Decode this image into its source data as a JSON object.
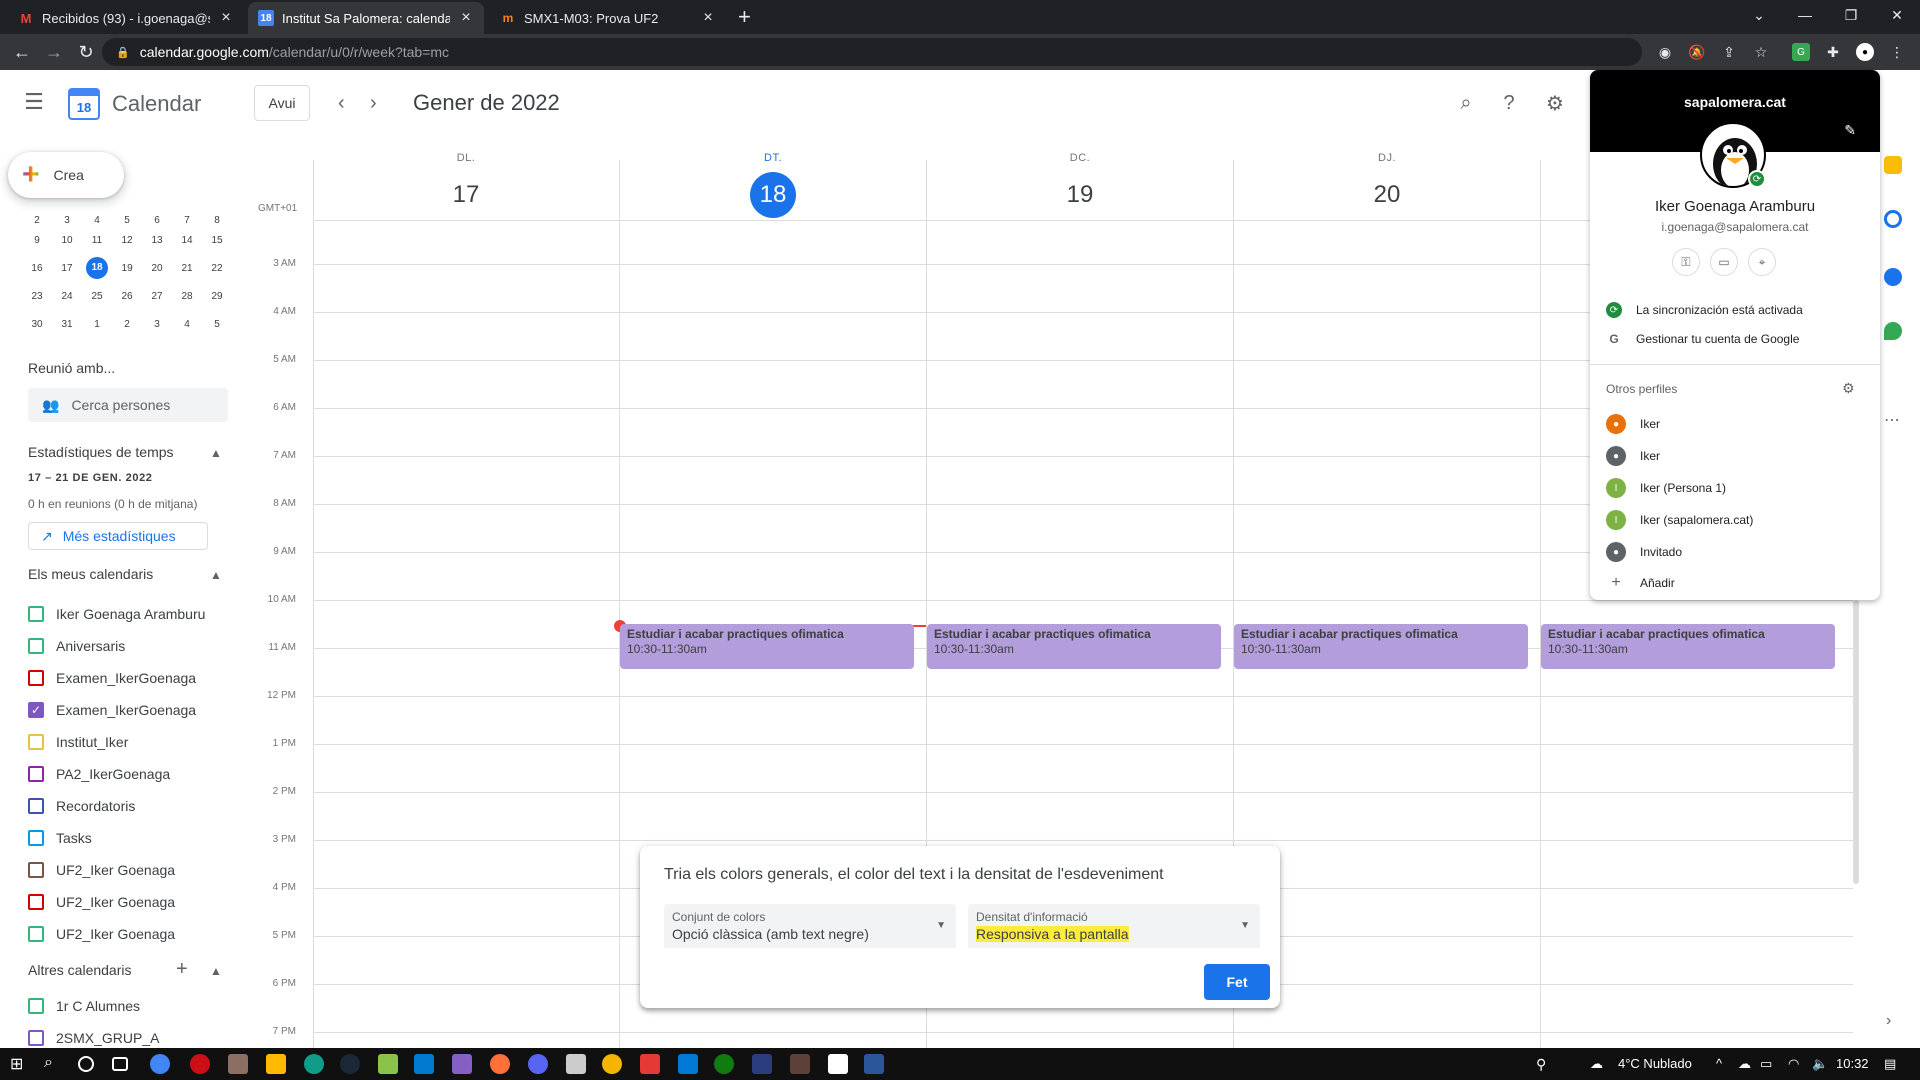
{
  "browser": {
    "tabs": [
      {
        "title": "Recibidos (93) - i.goenaga@sapa",
        "favicon": "gmail-icon"
      },
      {
        "title": "Institut Sa Palomera: calendari - S",
        "favicon": "calendar-icon"
      },
      {
        "title": "SMX1-M03: Prova UF2",
        "favicon": "moodle-icon"
      }
    ],
    "url_host": "calendar.google.com",
    "url_path": "/calendar/u/0/r/week?tab=mc"
  },
  "header": {
    "app_name": "Calendar",
    "logo_day": "18",
    "today_label": "Avui",
    "title": "Gener de 2022"
  },
  "sidebar": {
    "create_label": "Crea",
    "mini_calendar": [
      [
        "2",
        "3",
        "4",
        "5",
        "6",
        "7",
        "8"
      ],
      [
        "9",
        "10",
        "11",
        "12",
        "13",
        "14",
        "15"
      ],
      [
        "16",
        "17",
        "18",
        "19",
        "20",
        "21",
        "22"
      ],
      [
        "23",
        "24",
        "25",
        "26",
        "27",
        "28",
        "29"
      ],
      [
        "30",
        "31",
        "1",
        "2",
        "3",
        "4",
        "5"
      ]
    ],
    "meet_heading": "Reunió amb...",
    "search_people_placeholder": "Cerca persones",
    "stats_heading": "Estadístiques de temps",
    "stats_range": "17 – 21 DE GEN. 2022",
    "stats_summary": "0 h en reunions (0 h de mitjana)",
    "more_stats_label": "Més estadístiques",
    "my_calendars_heading": "Els meus calendaris",
    "my_calendars": [
      {
        "label": "Iker Goenaga Aramburu",
        "color": "#33b679",
        "checked": false
      },
      {
        "label": "Aniversaris",
        "color": "#33b679",
        "checked": false
      },
      {
        "label": "Examen_IkerGoenaga",
        "color": "#d50000",
        "checked": false
      },
      {
        "label": "Examen_IkerGoenaga",
        "color": "#7e57c2",
        "checked": true
      },
      {
        "label": "Institut_Iker",
        "color": "#e4c441",
        "checked": false
      },
      {
        "label": "PA2_IkerGoenaga",
        "color": "#8e24aa",
        "checked": false
      },
      {
        "label": "Recordatoris",
        "color": "#3f51b5",
        "checked": false
      },
      {
        "label": "Tasks",
        "color": "#039be5",
        "checked": false
      },
      {
        "label": "UF2_Iker Goenaga",
        "color": "#795548",
        "checked": false
      },
      {
        "label": "UF2_Iker Goenaga",
        "color": "#d50000",
        "checked": false
      },
      {
        "label": "UF2_Iker Goenaga",
        "color": "#33b679",
        "checked": false
      }
    ],
    "other_calendars_heading": "Altres calendaris",
    "other_calendars": [
      {
        "label": "1r C Alumnes",
        "color": "#33b679",
        "checked": false
      },
      {
        "label": "2SMX_GRUP_A",
        "color": "#7e57c2",
        "checked": false
      }
    ]
  },
  "week": {
    "timezone": "GMT+01",
    "days": [
      {
        "name": "DL.",
        "num": "17",
        "today": false
      },
      {
        "name": "DT.",
        "num": "18",
        "today": true
      },
      {
        "name": "DC.",
        "num": "19",
        "today": false
      },
      {
        "name": "DJ.",
        "num": "20",
        "today": false
      }
    ],
    "hours": [
      "3 AM",
      "4 AM",
      "5 AM",
      "6 AM",
      "7 AM",
      "8 AM",
      "9 AM",
      "10 AM",
      "11 AM",
      "12 PM",
      "1 PM",
      "2 PM",
      "3 PM",
      "4 PM",
      "5 PM",
      "6 PM",
      "7 PM"
    ],
    "events": [
      {
        "title": "Estudiar i acabar practiques ofimatica",
        "time": "10:30-11:30am"
      },
      {
        "title": "Estudiar i acabar practiques ofimatica",
        "time": "10:30-11:30am"
      },
      {
        "title": "Estudiar i acabar practiques ofimatica",
        "time": "10:30-11:30am"
      },
      {
        "title": "Estudiar i acabar practiques ofimatica",
        "time": "10:30-11:30am"
      }
    ],
    "event_color": "#b39ddb"
  },
  "dialog": {
    "title": "Tria els colors generals, el color del text i la densitat de l'esdeveniment",
    "color_set_label": "Conjunt de colors",
    "color_set_value": "Opció clàssica (amb text negre)",
    "density_label": "Densitat d'informació",
    "density_value": "Responsiva a la pantalla",
    "done_label": "Fet"
  },
  "profile": {
    "domain": "sapalomera.cat",
    "name": "Iker Goenaga Aramburu",
    "email": "i.goenaga@sapalomera.cat",
    "sync_status": "La sincronización está activada",
    "manage_account": "Gestionar tu cuenta de Google",
    "other_profiles_heading": "Otros perfiles",
    "other_profiles": [
      {
        "label": "Iker",
        "color": "#e8710a",
        "initial": ""
      },
      {
        "label": "Iker",
        "color": "#5f6368",
        "initial": ""
      },
      {
        "label": "Iker (Persona 1)",
        "color": "#7cb342",
        "initial": "I"
      },
      {
        "label": "Iker (sapalomera.cat)",
        "color": "#7cb342",
        "initial": "I"
      },
      {
        "label": "Invitado",
        "color": "#5f6368",
        "initial": ""
      }
    ],
    "add_label": "Añadir"
  },
  "taskbar": {
    "weather": "4°C  Nublado",
    "clock": "10:32"
  }
}
